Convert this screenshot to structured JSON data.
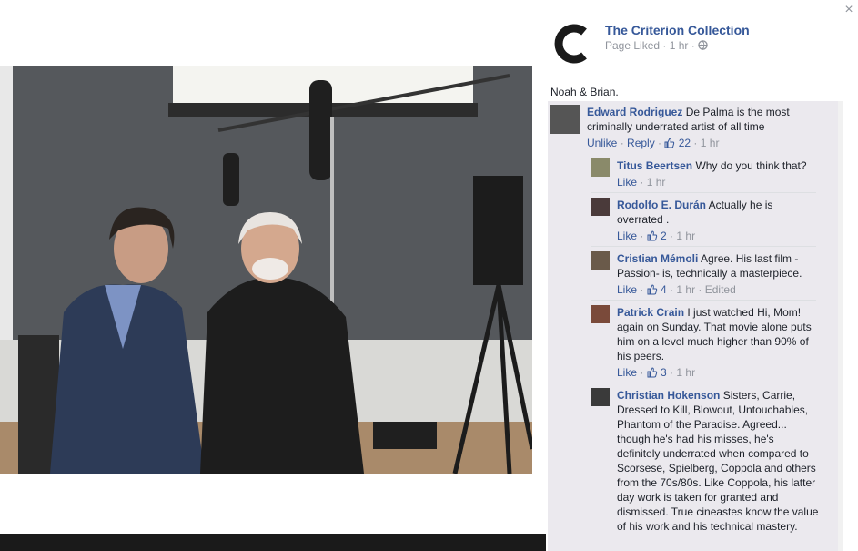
{
  "page": {
    "name": "The Criterion Collection",
    "meta": "Page Liked · 1 hr ·",
    "close_glyph": "×",
    "logo_icon": "criterion-c-logo",
    "post_text": "Noah & Brian."
  },
  "comments": {
    "top": {
      "author": "Edward Rodriguez",
      "text": "De Palma is the most criminally underrated artist of all time",
      "actions": {
        "unlike": "Unlike",
        "reply": "Reply",
        "likes": "22",
        "time": "1 hr"
      }
    },
    "replies": [
      {
        "author": "Titus Beertsen",
        "text": "Why do you think that?",
        "like": "Like",
        "likes": "",
        "time": "1 hr",
        "edited": ""
      },
      {
        "author": "Rodolfo E. Durán",
        "text": "Actually he is overrated .",
        "like": "Like",
        "likes": "2",
        "time": "1 hr",
        "edited": ""
      },
      {
        "author": "Cristian Mémoli",
        "text": "Agree. His last film - Passion- is, technically a masterpiece.",
        "like": "Like",
        "likes": "4",
        "time": "1 hr",
        "edited": "Edited"
      },
      {
        "author": "Patrick Crain",
        "text": "I just watched Hi, Mom! again on Sunday. That movie alone puts him on a level much higher than 90% of his peers.",
        "like": "Like",
        "likes": "3",
        "time": "1 hr",
        "edited": ""
      },
      {
        "author": "Christian Hokenson",
        "text": "Sisters, Carrie, Dressed to Kill, Blowout, Untouchables, Phantom of the Paradise. Agreed... though he's had his misses, he's definitely underrated when compared to Scorsese, Spielberg, Coppola and others from the 70s/80s. Like Coppola, his latter day work is taken for granted and dismissed. True cineastes know the value of his work and his technical mastery.",
        "like": "",
        "likes": "",
        "time": "",
        "edited": ""
      }
    ]
  },
  "colors": {
    "link": "#365899",
    "meta": "#90949c",
    "panel": "#ebe9ee"
  }
}
